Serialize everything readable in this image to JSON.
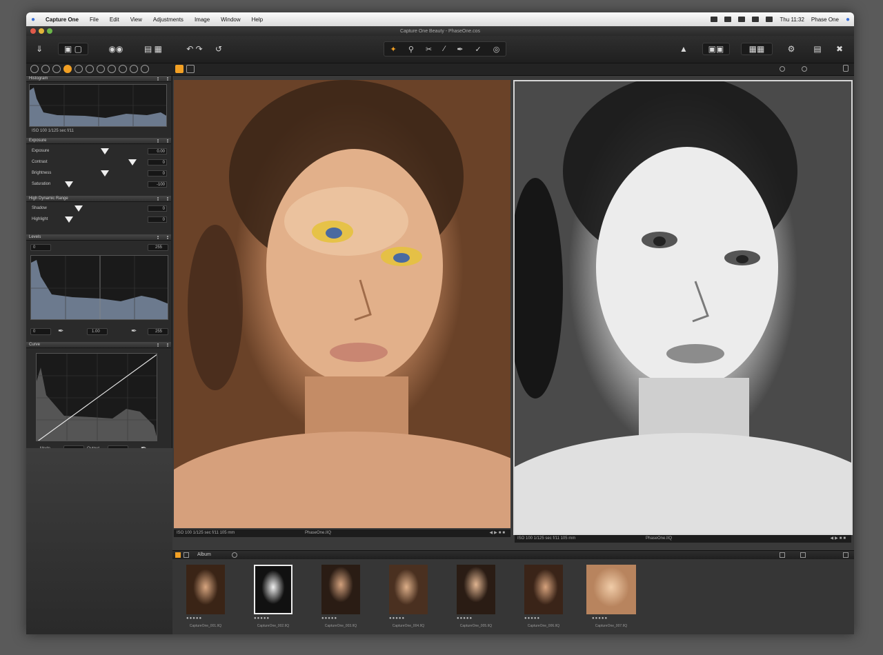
{
  "menubar": {
    "app_name": "Capture One",
    "items": [
      "File",
      "Edit",
      "View",
      "Adjustments",
      "Image",
      "Window",
      "Help"
    ],
    "clock": "Thu 11:32",
    "user": "Phase One"
  },
  "window": {
    "title": "Capture One Beauty - PhaseOne.cos"
  },
  "left_panel": {
    "histogram_title": "Histogram",
    "histogram_readout": "ISO 100   1/125 sec   f/11",
    "exposure_title": "Exposure",
    "exposure_rows": [
      {
        "label": "Exposure",
        "value": "0.00"
      },
      {
        "label": "Contrast",
        "value": "0"
      },
      {
        "label": "Brightness",
        "value": "0"
      },
      {
        "label": "Saturation",
        "value": "-100"
      }
    ],
    "hdr_title": "High Dynamic Range",
    "hdr_rows": [
      {
        "label": "Shadow",
        "value": "0"
      },
      {
        "label": "Highlight",
        "value": "0"
      }
    ],
    "levels_title": "Levels",
    "levels_top_left": "0",
    "levels_top_right": "255",
    "levels_bottom_left": "0",
    "levels_bottom_mid": "1.00",
    "levels_bottom_right": "255",
    "curve_title": "Curve",
    "curve_mode_label": "Mode",
    "curve_channel_label": "Output"
  },
  "viewer": {
    "left_info": "ISO 100   1/125 sec   f/11   105 mm",
    "left_filename": "PhaseOne.IIQ",
    "right_info": "ISO 100   1/125 sec   f/11   105 mm",
    "right_filename": "PhaseOne.IIQ"
  },
  "browser": {
    "title": "Album",
    "thumbnails": [
      {
        "filename": "CaptureOne_001.IIQ",
        "selected": false
      },
      {
        "filename": "CaptureOne_002.IIQ",
        "selected": true
      },
      {
        "filename": "CaptureOne_003.IIQ",
        "selected": false
      },
      {
        "filename": "CaptureOne_004.IIQ",
        "selected": false
      },
      {
        "filename": "CaptureOne_005.IIQ",
        "selected": false
      },
      {
        "filename": "CaptureOne_006.IIQ",
        "selected": false
      },
      {
        "filename": "CaptureOne_007.IIQ",
        "selected": false
      }
    ]
  },
  "colors": {
    "accent": "#f2a024",
    "background": "#2b2b2b",
    "desktop": "#5a5a5a"
  }
}
